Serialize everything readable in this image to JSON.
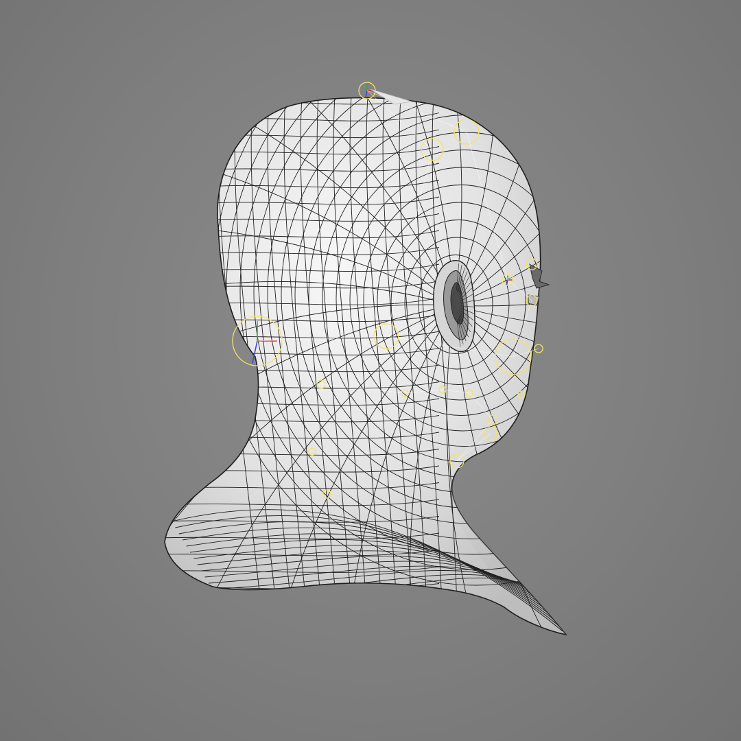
{
  "viewport": {
    "background_color": "#808080",
    "view": "perspective"
  },
  "model": {
    "object": "head-bust",
    "display_mode": "wireframe-on-shaded",
    "surface_color": "#e8e8e8",
    "wire_color": "#1e1e1e"
  },
  "rig": {
    "control_color": "#f2e36a",
    "axis_colors": {
      "x": "#d23a3a",
      "y": "#3aa83a",
      "z": "#3a4bd2"
    }
  }
}
